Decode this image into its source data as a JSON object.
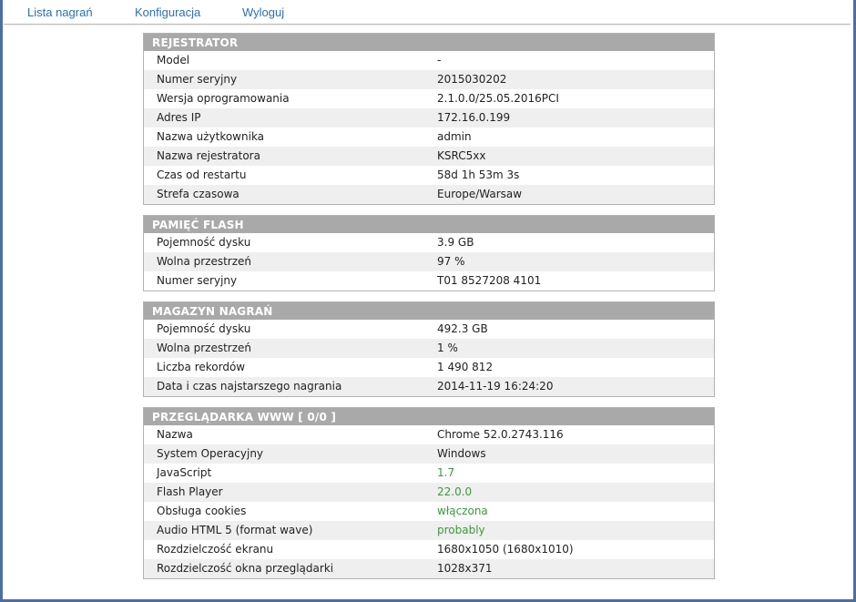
{
  "nav": {
    "recordings": "Lista nagrań",
    "config": "Konfiguracja",
    "logout": "Wyloguj"
  },
  "colors": {
    "link": "#2d6fb5",
    "header_bg": "#a9a9a9",
    "ok_value": "#3a9a3a",
    "frame": "#4a6fa5"
  },
  "sections": [
    {
      "title": "REJESTRATOR",
      "rows": [
        {
          "label": "Model",
          "value": "-"
        },
        {
          "label": "Numer seryjny",
          "value": "2015030202"
        },
        {
          "label": "Wersja oprogramowania",
          "value": "2.1.0.0/25.05.2016PCI"
        },
        {
          "label": "Adres IP",
          "value": "172.16.0.199"
        },
        {
          "label": "Nazwa użytkownika",
          "value": "admin"
        },
        {
          "label": "Nazwa rejestratora",
          "value": "KSRC5xx"
        },
        {
          "label": "Czas od restartu",
          "value": "58d 1h 53m 3s"
        },
        {
          "label": "Strefa czasowa",
          "value": "Europe/Warsaw"
        }
      ]
    },
    {
      "title": "PAMIĘĆ FLASH",
      "rows": [
        {
          "label": "Pojemność dysku",
          "value": "3.9 GB"
        },
        {
          "label": "Wolna przestrzeń",
          "value": "97 %"
        },
        {
          "label": "Numer seryjny",
          "value": "T01 8527208 4101"
        }
      ]
    },
    {
      "title": "MAGAZYN NAGRAŃ",
      "rows": [
        {
          "label": "Pojemność dysku",
          "value": "492.3 GB"
        },
        {
          "label": "Wolna przestrzeń",
          "value": "1 %"
        },
        {
          "label": "Liczba rekordów",
          "value": "1 490 812"
        },
        {
          "label": "Data i czas najstarszego nagrania",
          "value": "2014-11-19 16:24:20"
        }
      ]
    },
    {
      "title": "PRZEGLĄDARKA WWW [ 0/0 ]",
      "rows": [
        {
          "label": "Nazwa",
          "value": "Chrome 52.0.2743.116"
        },
        {
          "label": "System Operacyjny",
          "value": "Windows"
        },
        {
          "label": "JavaScript",
          "value": "1.7",
          "status": "ok"
        },
        {
          "label": "Flash Player",
          "value": "22.0.0",
          "status": "ok"
        },
        {
          "label": "Obsługa cookies",
          "value": "włączona",
          "status": "ok"
        },
        {
          "label": "Audio HTML 5 (format wave)",
          "value": "probably",
          "status": "ok"
        },
        {
          "label": "Rozdzielczość ekranu",
          "value": "1680x1050 (1680x1010)"
        },
        {
          "label": "Rozdzielczość okna przeglądarki",
          "value": "1028x371"
        }
      ]
    }
  ]
}
